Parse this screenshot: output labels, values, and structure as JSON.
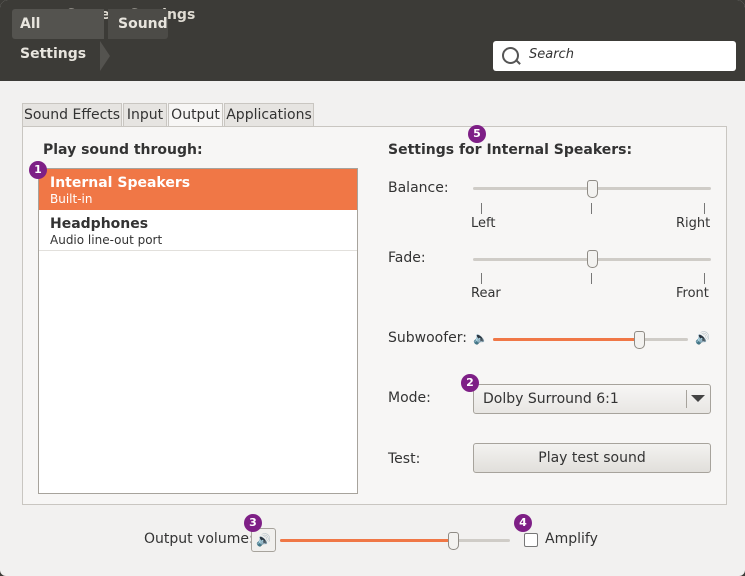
{
  "window": {
    "title": "System Settings"
  },
  "breadcrumb": {
    "items": [
      "All Settings",
      "Sound"
    ]
  },
  "search": {
    "placeholder": "Search"
  },
  "tabs": [
    {
      "label": "Sound Effects",
      "active": false
    },
    {
      "label": "Input",
      "active": false
    },
    {
      "label": "Output",
      "active": true
    },
    {
      "label": "Applications",
      "active": false
    }
  ],
  "left": {
    "heading": "Play sound through:",
    "devices": [
      {
        "name": "Internal Speakers",
        "description": "Built-in",
        "selected": true
      },
      {
        "name": "Headphones",
        "description": "Audio line-out port",
        "selected": false
      }
    ]
  },
  "right": {
    "heading": "Settings for Internal Speakers:",
    "balance": {
      "label": "Balance:",
      "left": "Left",
      "right": "Right",
      "value": 0.5
    },
    "fade": {
      "label": "Fade:",
      "left": "Rear",
      "right": "Front",
      "value": 0.5
    },
    "subwoofer": {
      "label": "Subwoofer:",
      "value": 0.75
    },
    "mode": {
      "label": "Mode:",
      "value": "Dolby Surround 6:1"
    },
    "test": {
      "label": "Test:",
      "button": "Play test sound"
    }
  },
  "bottom": {
    "volume_label": "Output volume:",
    "volume_value": 0.75,
    "amplify_label": "Amplify",
    "amplify_checked": false
  },
  "markers": [
    "1",
    "2",
    "3",
    "4",
    "5"
  ],
  "colors": {
    "accent": "#f07746",
    "marker": "#7e1f86",
    "titlebar": "#3c3b37"
  }
}
